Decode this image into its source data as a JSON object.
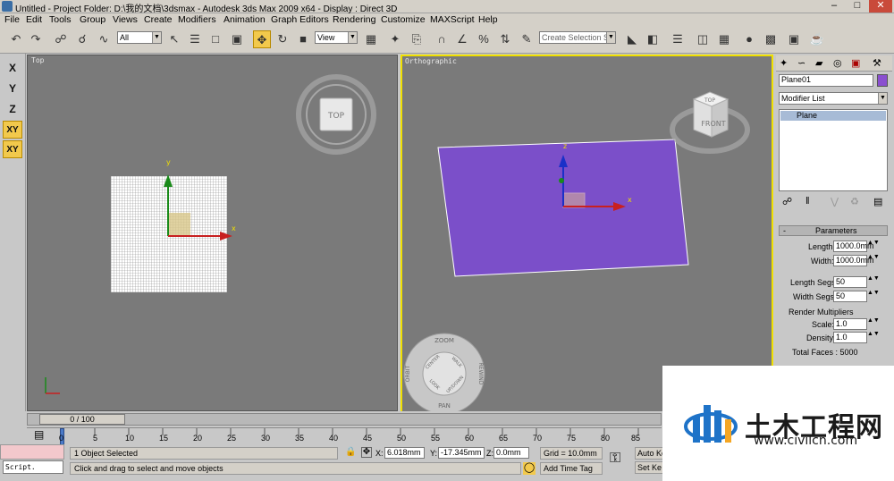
{
  "titlebar": {
    "title": "Untitled     - Project Folder: D:\\我的文档\\3dsmax     - Autodesk 3ds Max  2009 x64     - Display : Direct 3D"
  },
  "menu": [
    "File",
    "Edit",
    "Tools",
    "Group",
    "Views",
    "Create",
    "Modifiers",
    "Animation",
    "Graph Editors",
    "Rendering",
    "Customize",
    "MAXScript",
    "Help"
  ],
  "toolbar": {
    "selection_filter": "All",
    "reference_coord": "View",
    "named_selection": "Create Selection Se"
  },
  "left_axis_buttons": [
    "X",
    "Y",
    "Z",
    "XY",
    "XY"
  ],
  "viewports": {
    "top": {
      "label": "Top",
      "cube_face": "TOP",
      "gizmo_x": "x",
      "gizmo_y": "y"
    },
    "ortho": {
      "label": "Orthographic",
      "cube_top": "TOP",
      "cube_front": "FRONT",
      "gizmo_x": "x",
      "gizmo_z": "z",
      "wheel": {
        "zoom": "ZOOM",
        "orbit": "ORBIT",
        "center": "CENTER",
        "walk": "WALK",
        "rewind": "REWIND",
        "look": "LOOK",
        "updown": "UP/DOWN",
        "pan": "PAN"
      }
    }
  },
  "command_panel": {
    "object_name": "Plane01",
    "object_color": "#8a4fd0",
    "modifier_list": "Modifier List",
    "stack_item": "Plane",
    "rollout_title": "Parameters",
    "length_label": "Length:",
    "length_value": "1000.0mm",
    "width_label": "Width:",
    "width_value": "1000.0mm",
    "length_segs_label": "Length Segs:",
    "length_segs_value": "50",
    "width_segs_label": "Width Segs:",
    "width_segs_value": "50",
    "render_multipliers_label": "Render Multipliers",
    "scale_label": "Scale:",
    "scale_value": "1.0",
    "density_label": "Density:",
    "density_value": "1.0",
    "total_faces": "Total Faces : 5000"
  },
  "timeline": {
    "slider": "0 / 100",
    "ticks": [
      "0",
      "5",
      "10",
      "15",
      "20",
      "25",
      "30",
      "35",
      "40",
      "45",
      "50",
      "55",
      "60",
      "65",
      "70",
      "75",
      "80",
      "85"
    ]
  },
  "status": {
    "script_label": "Script.",
    "selected": "1 Object Selected",
    "prompt": "Click and drag to select and move objects",
    "x_label": "X:",
    "x_value": "6.018mm",
    "y_label": "Y:",
    "y_value": "-17.345mm",
    "z_label": "Z:",
    "z_value": "0.0mm",
    "grid": "Grid = 10.0mm",
    "add_time_tag": "Add Time Tag",
    "auto_key": "Auto Ke",
    "set_key": "Set Ke"
  },
  "watermark": {
    "cn": "土木工程网",
    "url": "www.civilcn.com"
  },
  "colors": {
    "viewport_bg": "#7a7a7a",
    "plane": "#7b4fc9",
    "active_border": "#f0e000",
    "active_button": "#f2c94c"
  }
}
